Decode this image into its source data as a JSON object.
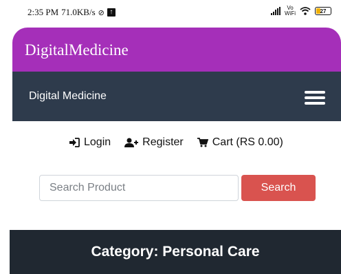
{
  "status_bar": {
    "time": "2:35 PM",
    "speed": "71.0KB/s",
    "battery": "27"
  },
  "app_bar": {
    "title": "DigitalMedicine",
    "color": "#a52fb9"
  },
  "navbar": {
    "brand": "Digital Medicine",
    "color": "#2e3b4c"
  },
  "auth": {
    "login": "Login",
    "register": "Register",
    "cart": "Cart (RS 0.00)"
  },
  "search": {
    "placeholder": "Search Product",
    "value": "",
    "button_label": "Search",
    "button_color": "#d9534f"
  },
  "category": {
    "title": "Category: Personal Care"
  },
  "icons": {
    "login": "sign-in-icon",
    "register": "user-plus-icon",
    "cart": "shopping-cart-icon",
    "menu": "hamburger-menu-icon"
  }
}
